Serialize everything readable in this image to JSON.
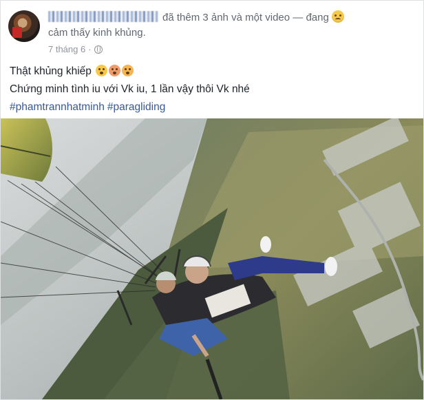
{
  "header": {
    "action_text": "đã thêm 3 ảnh và một video — đang",
    "feeling_text": "cảm thấy kinh khủng.",
    "timestamp": "7 tháng 6",
    "separator": "·"
  },
  "post": {
    "line1": "Thật khủng khiếp",
    "line2": "Chứng minh tình iu với Vk iu, 1 lần vậy thôi Vk nhé",
    "hashtags": [
      "#phamtrannhatminh",
      "#paragliding"
    ]
  },
  "icons": {
    "feeling": "worried-face-icon",
    "privacy": "globe-icon",
    "reactions": [
      "grimacing-face-icon",
      "flushed-face-icon",
      "frowning-face-icon"
    ]
  }
}
